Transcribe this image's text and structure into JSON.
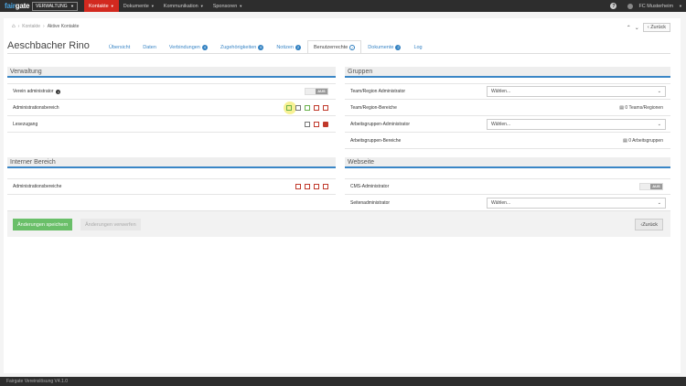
{
  "topbar": {
    "logo_a": "fair",
    "logo_b": "gate",
    "app_switch": "VERWALTUNG",
    "menu": [
      {
        "label": "Kontakte",
        "active": true
      },
      {
        "label": "Dokumente",
        "active": false
      },
      {
        "label": "Kommunikation",
        "active": false
      },
      {
        "label": "Sponsoren",
        "active": false
      }
    ],
    "help": "?",
    "club": "FC Musterheim"
  },
  "breadcrumb": {
    "item1": "Kontakte",
    "sep": "›",
    "item2": "Aktive Kontakte"
  },
  "nav": {
    "up": "⌃",
    "down": "⌄",
    "back": "Zurück"
  },
  "page": {
    "title": "Aeschbacher Rino",
    "tabs": [
      {
        "label": "Übersicht",
        "badge": ""
      },
      {
        "label": "Daten",
        "badge": ""
      },
      {
        "label": "Verbindungen",
        "badge": "4"
      },
      {
        "label": "Zugehörigkeiten",
        "badge": "6"
      },
      {
        "label": "Notizen",
        "badge": "2"
      },
      {
        "label": "Benutzerrechte",
        "badge": "✓"
      },
      {
        "label": "Dokumente",
        "badge": "2"
      },
      {
        "label": "Log",
        "badge": ""
      }
    ]
  },
  "verwaltung": {
    "title": "Verwaltung",
    "rows": [
      {
        "label": "Verein administrator",
        "toggle": "AUS"
      },
      {
        "label": "Administrationsbereich"
      },
      {
        "label": "Lesezugang"
      }
    ]
  },
  "intern": {
    "title": "Interner Bereich",
    "rows": [
      {
        "label": "Administrationsbereiche"
      }
    ]
  },
  "gruppen": {
    "title": "Gruppen",
    "rows": [
      {
        "label": "Team/Region Administrator",
        "select": "Wählen..."
      },
      {
        "label": "Team/Region-Bereiche",
        "value": "0 Teams/Regionen"
      },
      {
        "label": "Arbeitsgruppen-Administrator",
        "select": "Wählen..."
      },
      {
        "label": "Arbeitsgruppen-Bereiche",
        "value": "0 Arbeitsgruppen"
      }
    ]
  },
  "webseite": {
    "title": "Webseite",
    "rows": [
      {
        "label": "CMS-Administrator",
        "toggle": "AUS"
      },
      {
        "label": "Seitenadministrator",
        "select": "Wählen..."
      }
    ]
  },
  "actions": {
    "save": "Änderungen speichern",
    "discard": "Änderungen verwerfen",
    "back": "Zurück"
  },
  "footer": "Fairgate Vereinslösung V4.1.0",
  "colors": {
    "accent": "#3a86c6",
    "active_menu": "#d2291f",
    "save": "#6abf69"
  }
}
